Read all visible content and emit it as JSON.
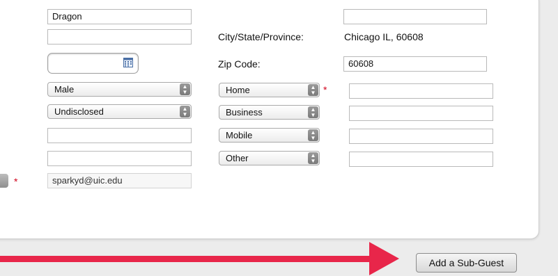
{
  "form": {
    "last_name_value": "Dragon",
    "address2_value": "",
    "birthdate_value": "",
    "gender_selected": "Male",
    "ethnicity_selected": "Undisclosed",
    "extra_field_1_value": "",
    "extra_field_2_value": "",
    "email_value": "sparkyd@uic.edu",
    "city_label": "City/State/Province:",
    "city_value": "Chicago IL, 60608",
    "zip_label": "Zip Code:",
    "zip_value": "60608",
    "top_right_value": "",
    "phone_types": [
      {
        "label": "Home",
        "value": ""
      },
      {
        "label": "Business",
        "value": ""
      },
      {
        "label": "Mobile",
        "value": ""
      },
      {
        "label": "Other",
        "value": ""
      }
    ],
    "required_marker": "*"
  },
  "actions": {
    "add_subguest_label": "Add a Sub-Guest"
  },
  "annotation": {
    "arrow_color": "#e8264a"
  },
  "icons": {
    "calendar": "calendar-icon",
    "select_arrow": "updown-chevron-icon"
  }
}
